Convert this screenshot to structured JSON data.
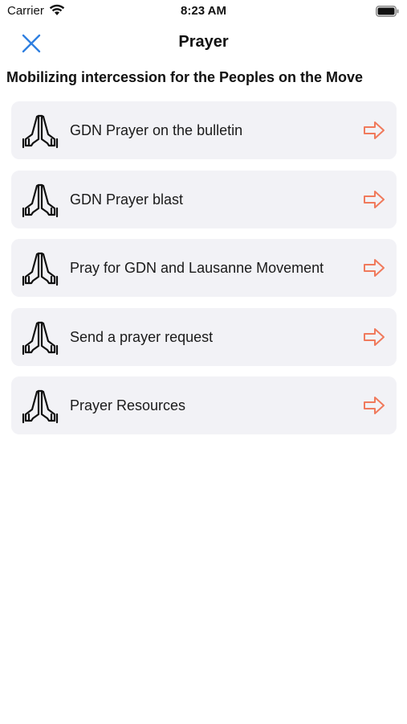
{
  "status_bar": {
    "carrier": "Carrier",
    "time": "8:23 AM"
  },
  "nav": {
    "title": "Prayer",
    "close_icon": "close-icon"
  },
  "subtitle": "Mobilizing intercession for the Peoples on the Move",
  "menu": {
    "items": [
      {
        "label": "GDN Prayer on the bulletin",
        "icon": "praying-hands-icon",
        "action_icon": "arrow-right-icon"
      },
      {
        "label": "GDN Prayer blast",
        "icon": "praying-hands-icon",
        "action_icon": "arrow-right-icon"
      },
      {
        "label": "Pray for GDN and Lausanne Movement",
        "icon": "praying-hands-icon",
        "action_icon": "arrow-right-icon"
      },
      {
        "label": "Send a prayer request",
        "icon": "praying-hands-icon",
        "action_icon": "arrow-right-icon"
      },
      {
        "label": "Prayer Resources",
        "icon": "praying-hands-icon",
        "action_icon": "arrow-right-icon"
      }
    ]
  },
  "colors": {
    "accent_blue": "#2f7fe0",
    "arrow_orange": "#f07a5c",
    "card_background": "#f2f2f6"
  }
}
